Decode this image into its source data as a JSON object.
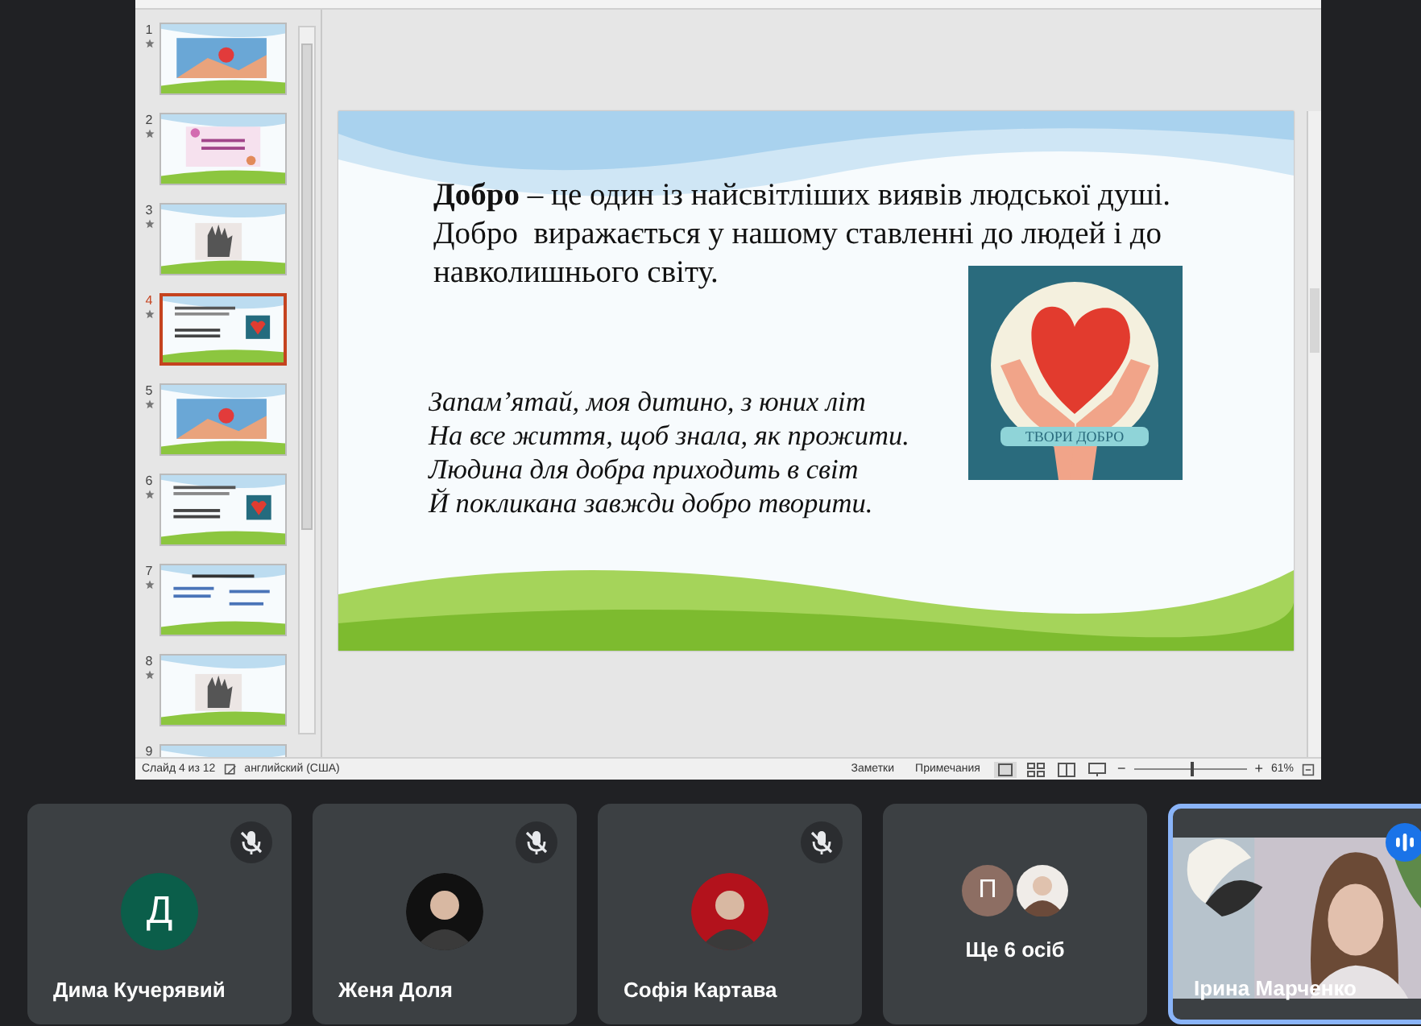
{
  "presentation": {
    "thumbnails": [
      {
        "number": "1",
        "selected": false,
        "transition": true
      },
      {
        "number": "2",
        "selected": false,
        "transition": true,
        "kind": "flowers"
      },
      {
        "number": "3",
        "selected": false,
        "transition": true,
        "kind": "hand"
      },
      {
        "number": "4",
        "selected": true,
        "transition": true,
        "kind": "text"
      },
      {
        "number": "5",
        "selected": false,
        "transition": true
      },
      {
        "number": "6",
        "selected": false,
        "transition": true,
        "kind": "text"
      },
      {
        "number": "7",
        "selected": false,
        "transition": true,
        "kind": "list"
      },
      {
        "number": "8",
        "selected": false,
        "transition": true,
        "kind": "hand"
      },
      {
        "number": "9",
        "selected": false
      }
    ],
    "slide": {
      "heading": "**Добро** – це один із найсвітліших виявів людської душі. Добро  виражається у нашому ставленні до людей і до навколишнього світу.",
      "poem": [
        "Запам’ятай, моя дитино, з юних літ",
        "На все життя, щоб знала, як прожити.",
        "Людина для добра приходить в світ",
        "Й покликана завжди добро творити."
      ],
      "logo_banner": "ТВОРИ ДОБРО"
    },
    "status_bar": {
      "slide_counter": "Слайд 4 из 12",
      "language": "английский (США)",
      "notes": "Заметки",
      "comments": "Примечания",
      "zoom": {
        "minus": "−",
        "level": 0.5,
        "plus": "+",
        "reading": "61%"
      }
    }
  },
  "participants": [
    {
      "kind": "letter",
      "name": "Дима Кучерявий",
      "letter": "Д",
      "color": "#0b5e4a",
      "muted": true
    },
    {
      "name": "Женя Доля",
      "color": "#111111",
      "muted": true
    },
    {
      "name": "Софія Картава",
      "color": "#b3121c",
      "muted": true
    },
    {
      "kind": "group",
      "label": "Ще 6 осіб",
      "letter": "П",
      "color": "#8d6e63",
      "muted": false
    },
    {
      "kind": "video",
      "name": "Ірина Марченко",
      "muted": false,
      "speaking": true
    }
  ]
}
